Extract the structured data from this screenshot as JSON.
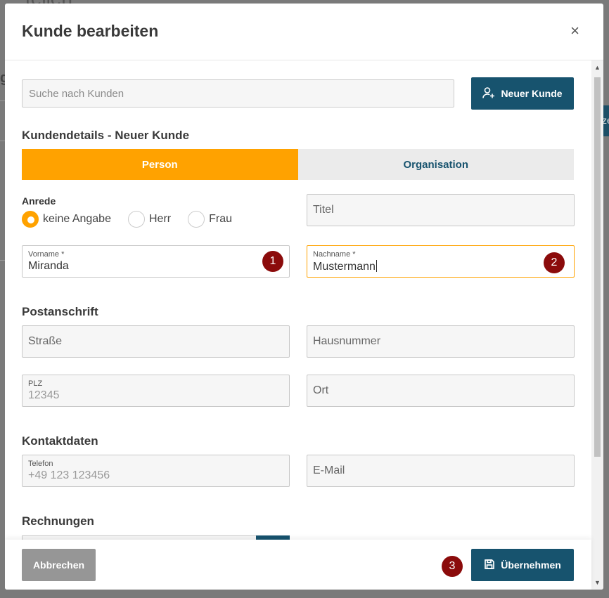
{
  "background": {
    "title_fragment": "tellen",
    "side_letter": "g",
    "right_btn_fragment": "ze"
  },
  "modal": {
    "title": "Kunde bearbeiten",
    "close_glyph": "×"
  },
  "search": {
    "placeholder": "Suche nach Kunden",
    "new_customer_label": "Neuer Kunde",
    "new_customer_icon": "user-plus-icon"
  },
  "customer_details": {
    "heading": "Kundendetails - Neuer Kunde",
    "tabs": [
      {
        "label": "Person",
        "active": true
      },
      {
        "label": "Organisation",
        "active": false
      }
    ],
    "salutation": {
      "label": "Anrede",
      "options": [
        {
          "label": "keine Angabe",
          "checked": true
        },
        {
          "label": "Herr",
          "checked": false
        },
        {
          "label": "Frau",
          "checked": false
        }
      ]
    },
    "title_placeholder": "Titel",
    "first_name": {
      "label": "Vorname *",
      "value": "Miranda"
    },
    "last_name": {
      "label": "Nachname *",
      "value": "Mustermann"
    }
  },
  "postal": {
    "heading": "Postanschrift",
    "street_placeholder": "Straße",
    "house_number_placeholder": "Hausnummer",
    "zip": {
      "label": "PLZ",
      "value": "12345"
    },
    "city_placeholder": "Ort"
  },
  "contact": {
    "heading": "Kontaktdaten",
    "phone": {
      "label": "Telefon",
      "value": "+49 123 123456"
    },
    "email_placeholder": "E-Mail"
  },
  "invoices": {
    "heading": "Rechnungen"
  },
  "footer": {
    "cancel_label": "Abbrechen",
    "apply_label": "Übernehmen",
    "apply_icon": "save-icon"
  },
  "badges": [
    "1",
    "2",
    "3"
  ],
  "colors": {
    "accent_orange": "#ffa200",
    "primary_teal": "#17536e",
    "badge_red": "#8b0b0b",
    "cancel_gray": "#969696"
  }
}
